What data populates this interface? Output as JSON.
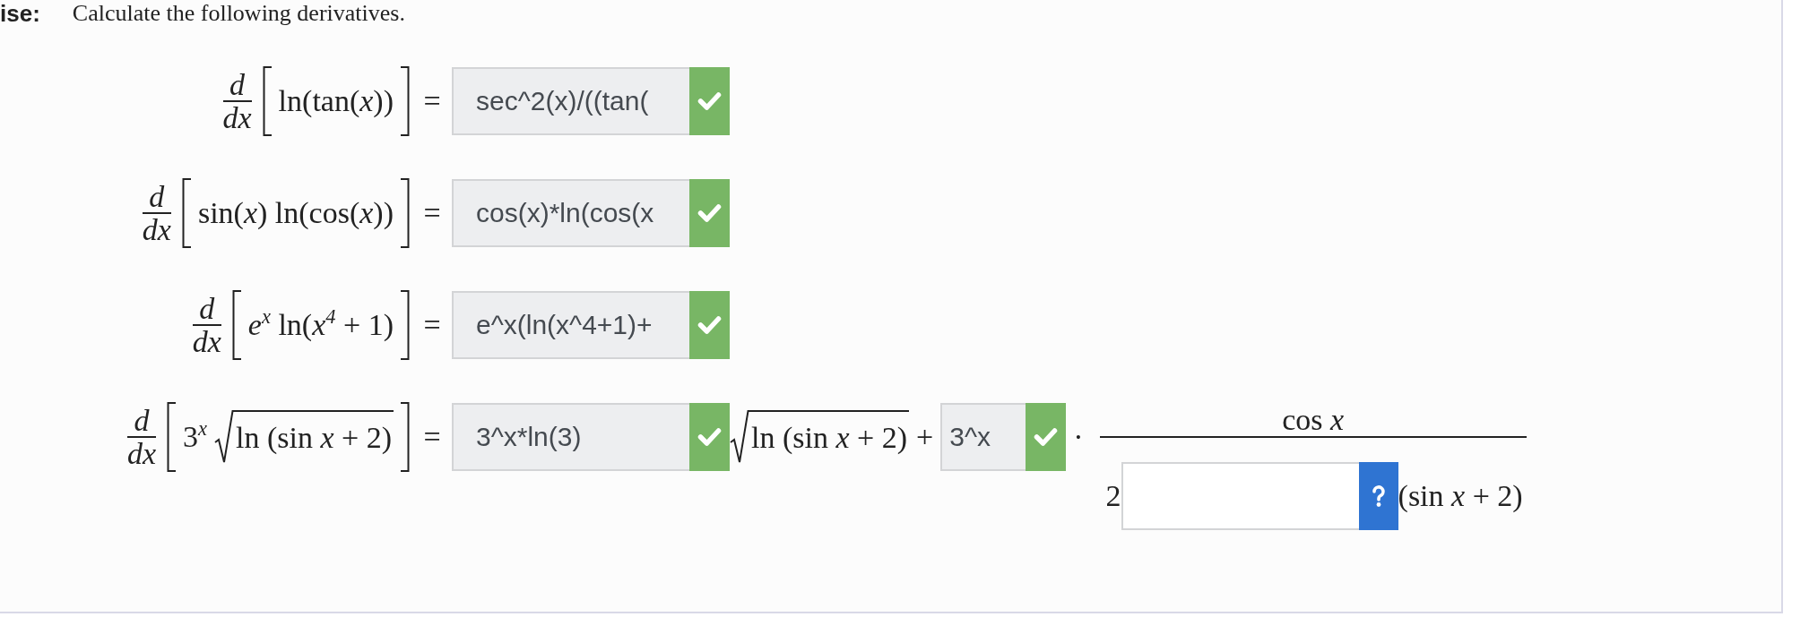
{
  "header": {
    "label": "ise:",
    "instruction": "Calculate the following derivatives."
  },
  "problems": [
    {
      "operator": {
        "numerator": "d",
        "denominator": "dx"
      },
      "expression": [
        {
          "kind": "text",
          "text": "ln(tan(*x*))"
        }
      ],
      "equals": "=",
      "answer": [
        {
          "kind": "field",
          "value": "sec^2(x)/((tan(",
          "correct": true
        }
      ]
    },
    {
      "operator": {
        "numerator": "d",
        "denominator": "dx"
      },
      "expression": [
        {
          "kind": "text",
          "text": "sin(*x*) ln(cos(*x*))"
        }
      ],
      "equals": "=",
      "answer": [
        {
          "kind": "field",
          "value": "cos(x)*ln(cos(x",
          "correct": true
        }
      ]
    },
    {
      "operator": {
        "numerator": "d",
        "denominator": "dx"
      },
      "expression": [
        {
          "kind": "text",
          "text": "*e*$^{x}$ ln(*x*$^{4}$ + 1)"
        }
      ],
      "equals": "=",
      "answer": [
        {
          "kind": "field",
          "value": "e^x(ln(x^4+1)+",
          "correct": true
        }
      ]
    },
    {
      "operator": {
        "numerator": "d",
        "denominator": "dx"
      },
      "expression": [
        {
          "kind": "text",
          "text": "3$^{x}$"
        },
        {
          "kind": "radical",
          "radicand": "ln (sin *x* + 2)"
        }
      ],
      "equals": "=",
      "answer": [
        {
          "kind": "field",
          "value": "3^x*ln(3)",
          "correct": true
        },
        {
          "kind": "radical",
          "radicand": "ln (sin *x* + 2)"
        },
        {
          "kind": "operator",
          "text": "+"
        },
        {
          "kind": "field",
          "value": "3^x",
          "correct": true
        },
        {
          "kind": "operator",
          "text": "·"
        },
        {
          "kind": "fraction",
          "numerator": "cos *x*",
          "denominator": [
            {
              "kind": "text",
              "text": "2"
            },
            {
              "kind": "field",
              "correct": false
            },
            {
              "kind": "text",
              "text": "(sin *x* + 2)"
            }
          ]
        }
      ]
    }
  ]
}
